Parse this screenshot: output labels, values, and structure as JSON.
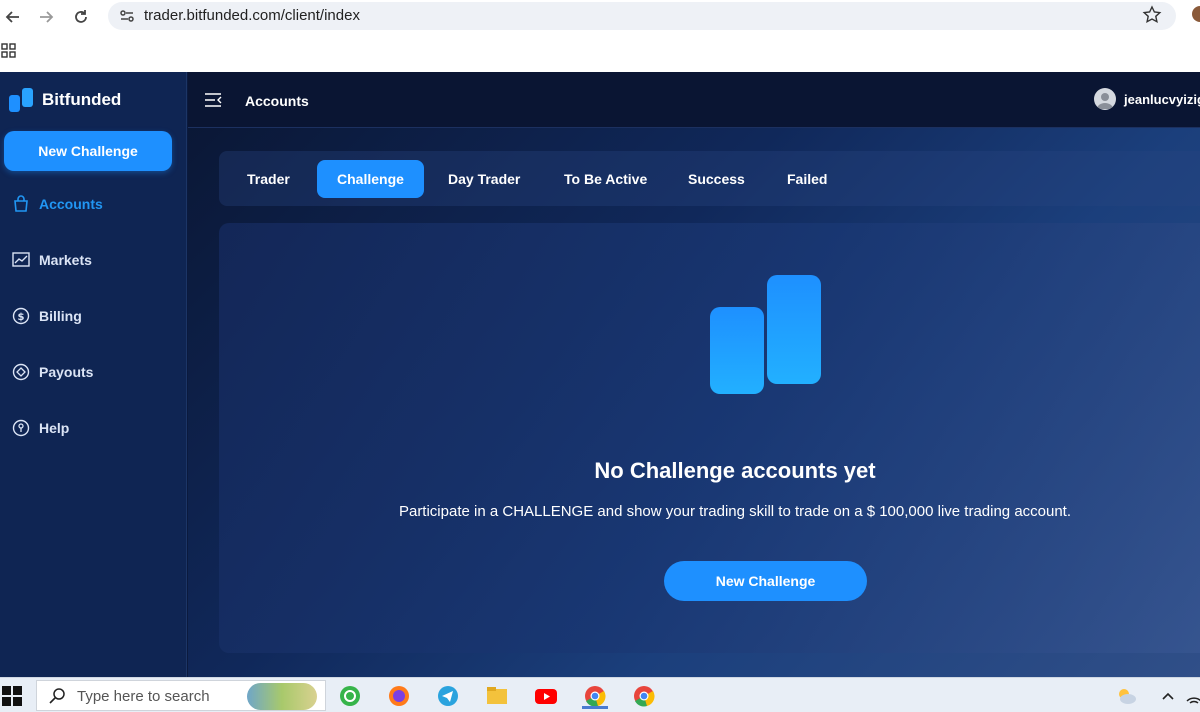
{
  "browser": {
    "url": "trader.bitfunded.com/client/index"
  },
  "app": {
    "brand": "Bitfunded",
    "accent_color": "#1e90ff",
    "sidebar": {
      "cta_label": "New Challenge",
      "items": [
        {
          "label": "Accounts",
          "icon": "bag-icon",
          "active": true
        },
        {
          "label": "Markets",
          "icon": "chart-icon",
          "active": false
        },
        {
          "label": "Billing",
          "icon": "dollar-circle-icon",
          "active": false
        },
        {
          "label": "Payouts",
          "icon": "diamond-circle-icon",
          "active": false
        },
        {
          "label": "Help",
          "icon": "help-icon",
          "active": false
        }
      ]
    },
    "topbar": {
      "title": "Accounts",
      "username": "jeanlucvyizig"
    },
    "tabs": [
      {
        "label": "Trader",
        "active": false
      },
      {
        "label": "Challenge",
        "active": true
      },
      {
        "label": "Day Trader",
        "active": false
      },
      {
        "label": "To Be Active",
        "active": false
      },
      {
        "label": "Success",
        "active": false
      },
      {
        "label": "Failed",
        "active": false
      }
    ],
    "empty_state": {
      "title": "No Challenge accounts yet",
      "description": "Participate in a CHALLENGE and show your trading skill to trade on a $ 100,000 live trading account.",
      "cta_label": "New Challenge"
    }
  },
  "taskbar": {
    "search_placeholder": "Type here to search"
  }
}
